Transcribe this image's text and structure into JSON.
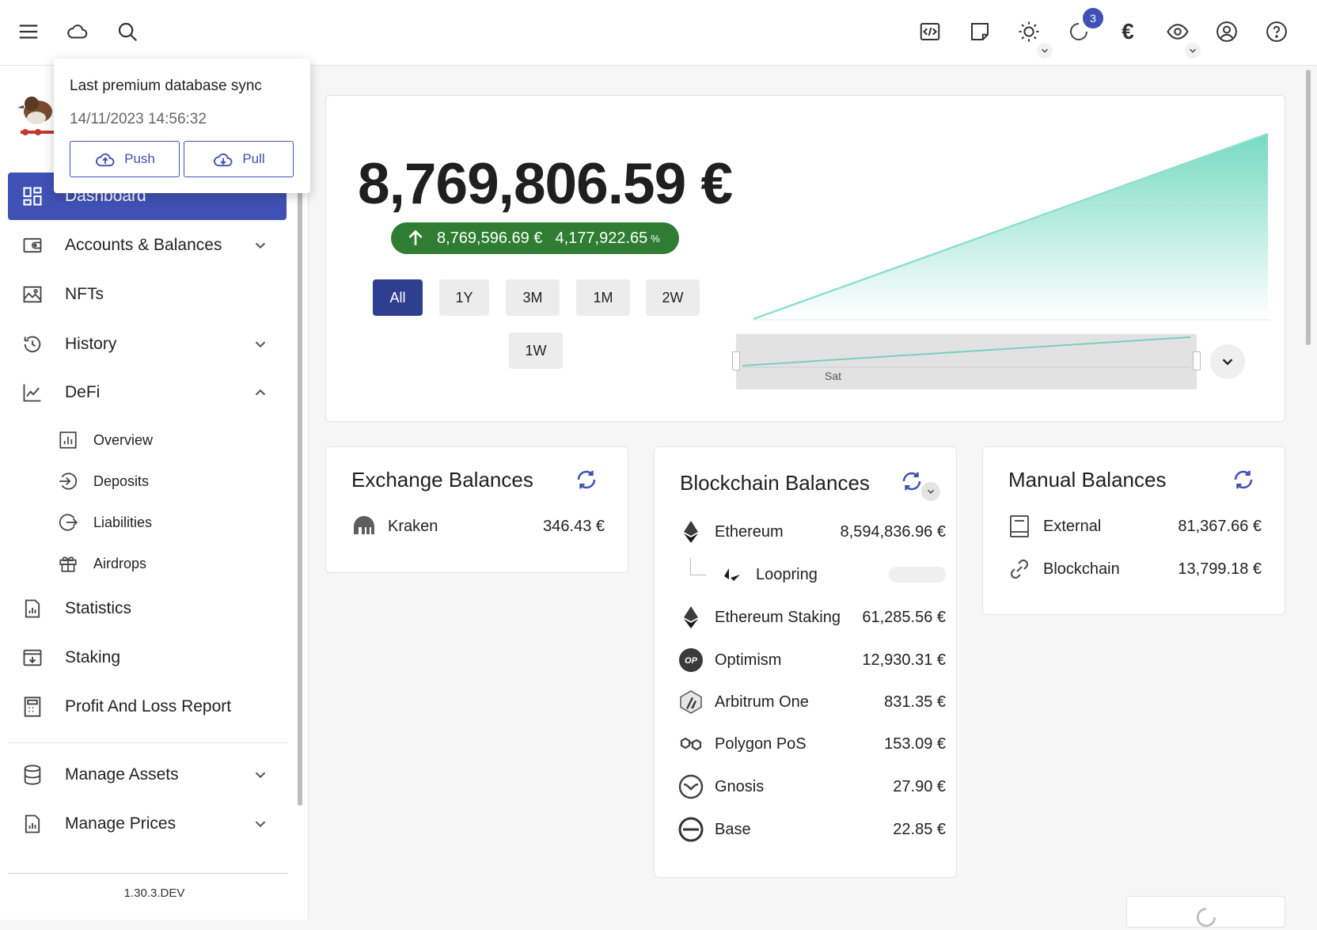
{
  "topbar": {
    "icons": [
      "menu-icon",
      "cloud-icon",
      "search-icon",
      "code-icon",
      "note-icon",
      "sun-icon",
      "loading-icon",
      "euro-icon",
      "eye-icon",
      "account-icon",
      "help-icon"
    ],
    "notification_count": "3",
    "currency_symbol": "€"
  },
  "sync_popup": {
    "title": "Last premium database sync",
    "date": "14/11/2023 14:56:32",
    "push_label": "Push",
    "pull_label": "Pull"
  },
  "sidebar": {
    "items": [
      {
        "label": "Dashboard",
        "icon": "dashboard-icon",
        "active": true
      },
      {
        "label": "Accounts & Balances",
        "icon": "wallet-icon"
      },
      {
        "label": "NFTs",
        "icon": "image-icon"
      },
      {
        "label": "History",
        "icon": "history-icon"
      },
      {
        "label": "DeFi",
        "icon": "chart-line-icon"
      },
      {
        "label": "Statistics",
        "icon": "statistics-icon"
      },
      {
        "label": "Staking",
        "icon": "staking-icon"
      },
      {
        "label": "Profit And Loss Report",
        "icon": "calculator-icon"
      },
      {
        "label": "Manage Assets",
        "icon": "database-icon"
      },
      {
        "label": "Manage Prices",
        "icon": "prices-icon"
      }
    ],
    "defi_sub": [
      {
        "label": "Overview",
        "icon": "overview-icon"
      },
      {
        "label": "Deposits",
        "icon": "deposit-icon"
      },
      {
        "label": "Liabilities",
        "icon": "liabilities-icon"
      },
      {
        "label": "Airdrops",
        "icon": "gift-icon"
      }
    ],
    "version": "1.30.3.DEV"
  },
  "overview": {
    "total": "8,769,806.59 €",
    "change_value": "8,769,596.69 €",
    "change_percent": "4,177,922.65",
    "percent_sign": "%",
    "timeframes": [
      "All",
      "1Y",
      "3M",
      "1M",
      "2W",
      "1W"
    ],
    "selected_timeframe": "All",
    "range_label": "Sat",
    "accent_color": "#5fd3b9"
  },
  "exchange_balances": {
    "title": "Exchange Balances",
    "rows": [
      {
        "name": "Kraken",
        "value": "346.43 €",
        "icon": "kraken-icon"
      }
    ]
  },
  "blockchain_balances": {
    "title": "Blockchain Balances",
    "rows": [
      {
        "name": "Ethereum",
        "value": "8,594,836.96 €",
        "icon": "ethereum-icon"
      },
      {
        "name": "Loopring",
        "value": "",
        "icon": "loopring-icon"
      },
      {
        "name": "Ethereum Staking",
        "value": "61,285.56 €",
        "icon": "ethereum-icon"
      },
      {
        "name": "Optimism",
        "value": "12,930.31 €",
        "icon": "optimism-icon"
      },
      {
        "name": "Arbitrum One",
        "value": "831.35 €",
        "icon": "arbitrum-icon"
      },
      {
        "name": "Polygon PoS",
        "value": "153.09 €",
        "icon": "polygon-icon"
      },
      {
        "name": "Gnosis",
        "value": "27.90 €",
        "icon": "gnosis-icon"
      },
      {
        "name": "Base",
        "value": "22.85 €",
        "icon": "base-icon"
      }
    ]
  },
  "manual_balances": {
    "title": "Manual Balances",
    "rows": [
      {
        "name": "External",
        "value": "81,367.66 €",
        "icon": "book-icon"
      },
      {
        "name": "Blockchain",
        "value": "13,799.18 €",
        "icon": "link-icon"
      }
    ]
  }
}
